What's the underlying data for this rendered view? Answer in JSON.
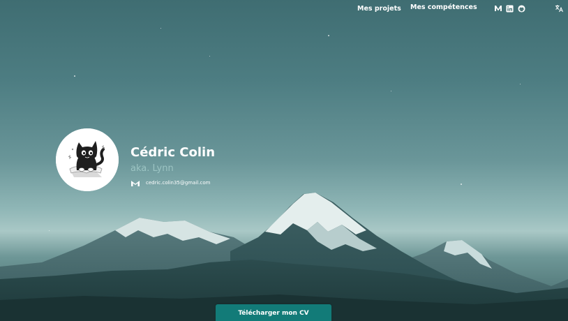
{
  "nav": {
    "projects_label": "Mes projets",
    "skills_label": "Mes compétences",
    "social_icons": [
      "medium-icon",
      "linkedin-icon",
      "github-icon"
    ],
    "translate_icon": "translate-icon"
  },
  "profile": {
    "name": "Cédric Colin",
    "alias": "aka. Lynn",
    "email": "cedric.colin35@gmail.com",
    "email_icon": "gmail-icon",
    "avatar": "cat-avatar"
  },
  "cv_button": {
    "label": "Télécharger mon CV"
  },
  "colors": {
    "accent": "#127b78",
    "alias_text": "#9cc4c3",
    "sky_top": "#3f6d72",
    "sky_bottom": "#a9c8c6"
  }
}
